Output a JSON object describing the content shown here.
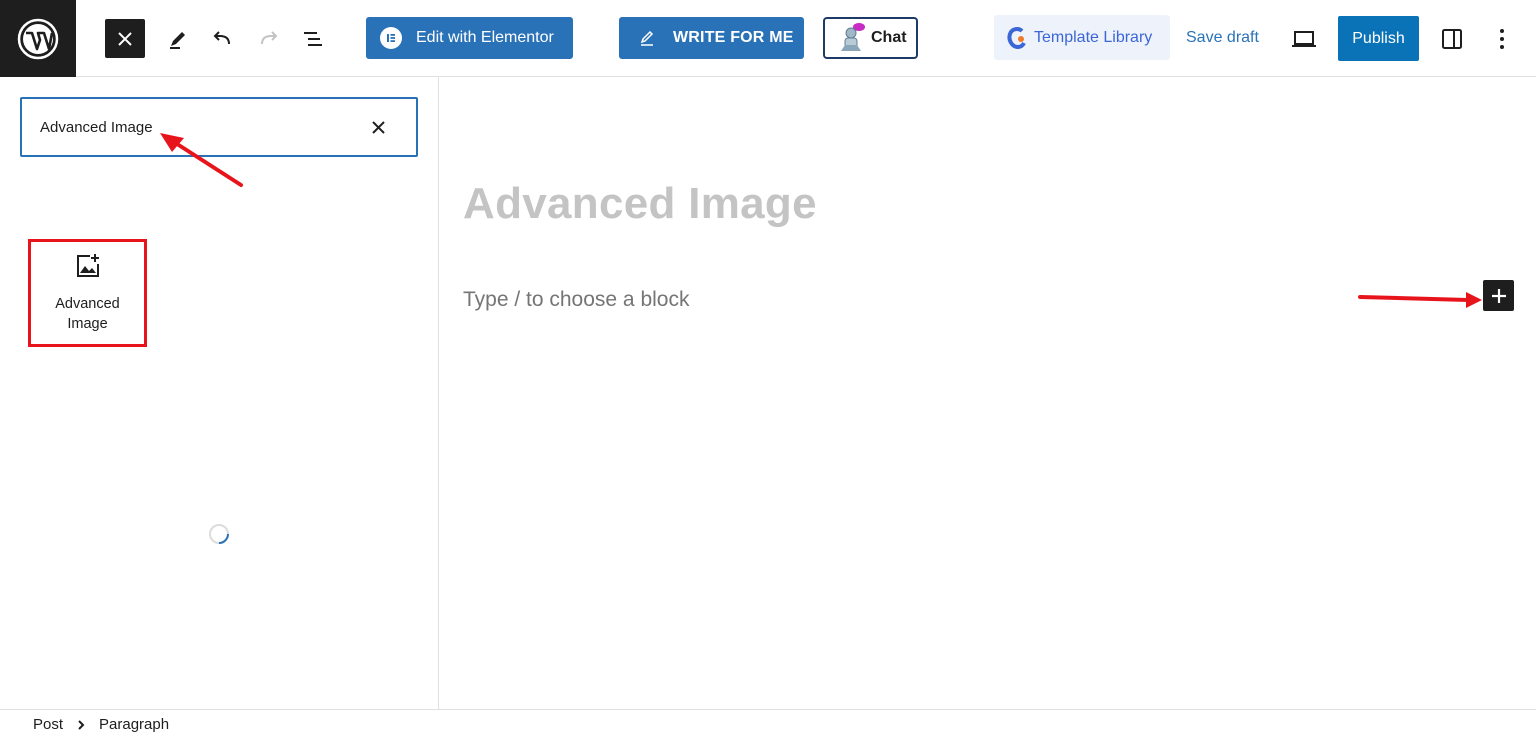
{
  "toolbar": {
    "elementor_label": "Edit with Elementor",
    "write_label": "WRITE FOR ME",
    "chat_label": "Chat",
    "template_library_label": "Template Library",
    "save_draft_label": "Save draft",
    "publish_label": "Publish",
    "icons": [
      "wordpress-logo",
      "close-icon",
      "pencil-icon",
      "undo-icon",
      "redo-icon",
      "list-view-icon",
      "elementor-icon",
      "edit-pen-icon",
      "chat-robot-icon",
      "template-library-logo",
      "preview-laptop-icon",
      "sidebar-toggle-icon",
      "more-options-icon"
    ]
  },
  "inserter": {
    "search_value": "Advanced Image",
    "results": [
      {
        "label": "Advanced Image",
        "icon": "image-add-icon"
      }
    ]
  },
  "editor": {
    "title": "Advanced Image",
    "block_placeholder": "Type / to choose a block"
  },
  "breadcrumb": {
    "items": [
      "Post",
      "Paragraph"
    ]
  },
  "colors": {
    "primary_blue": "#2a72b8",
    "publish_blue": "#0a73b8",
    "annotation_red": "#e8141c",
    "dark": "#1e1e1e"
  }
}
